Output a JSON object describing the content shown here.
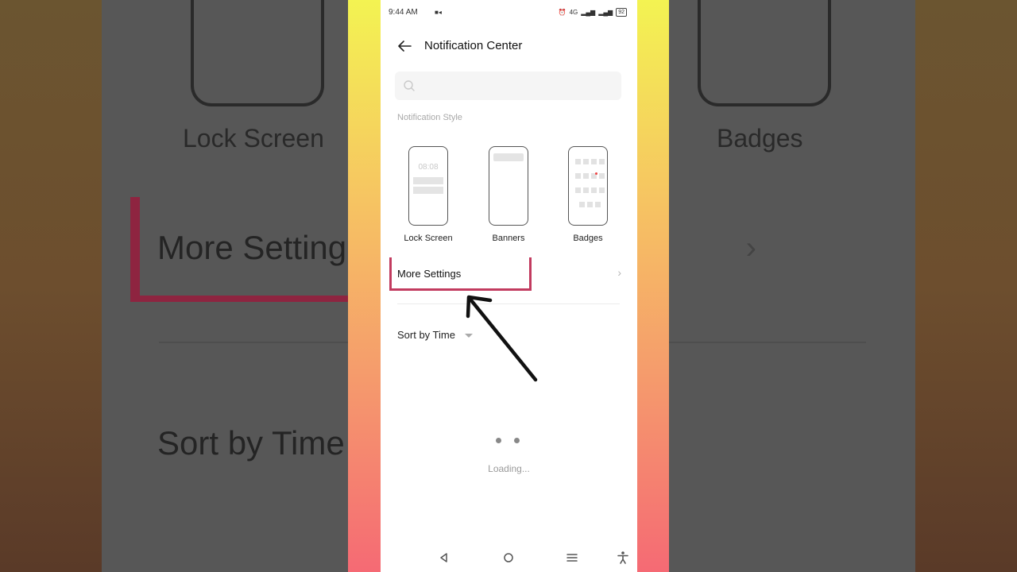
{
  "status": {
    "time": "9:44 AM",
    "network": "4G",
    "battery": "92"
  },
  "header": {
    "title": "Notification Center"
  },
  "search": {
    "placeholder": ""
  },
  "notification_style": {
    "label": "Notification Style",
    "options": [
      {
        "label": "Lock Screen",
        "preview_time": "08:08"
      },
      {
        "label": "Banners"
      },
      {
        "label": "Badges"
      }
    ]
  },
  "more_settings": {
    "label": "More Settings"
  },
  "sort": {
    "label": "Sort by Time"
  },
  "loading": {
    "label": "Loading..."
  },
  "background": {
    "lock_screen": "Lock Screen",
    "badges": "Badges",
    "more_settings": "More Setting",
    "sort_by_time": "Sort by Time"
  },
  "colors": {
    "highlight": "#c23b5f",
    "frame_top": "#f3f352",
    "frame_bottom": "#f56a74"
  }
}
